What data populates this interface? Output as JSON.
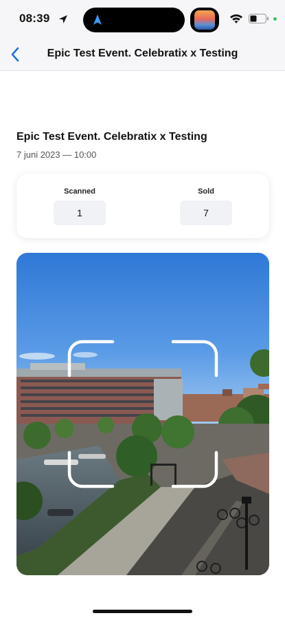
{
  "status_bar": {
    "time": "08:39",
    "icons": [
      "location-arrow-icon",
      "navigation-app-icon",
      "app-thumbnail-icon",
      "wifi-icon",
      "battery-icon"
    ],
    "accent": "#1e90ff",
    "battery_dot_color": "#34c759"
  },
  "nav": {
    "back_icon": "chevron-left-icon",
    "title": "Epic Test Event. Celebratix x Testing",
    "accent": "#1a73e8"
  },
  "event": {
    "title": "Epic Test Event. Celebratix x Testing",
    "date": "7 juni 2023 — 10:00"
  },
  "stats": {
    "scanned": {
      "label": "Scanned",
      "value": "1"
    },
    "sold": {
      "label": "Sold",
      "value": "7"
    }
  },
  "scanner": {
    "frame_icon": "qr-scan-frame-icon",
    "frame_color": "#ffffff"
  }
}
